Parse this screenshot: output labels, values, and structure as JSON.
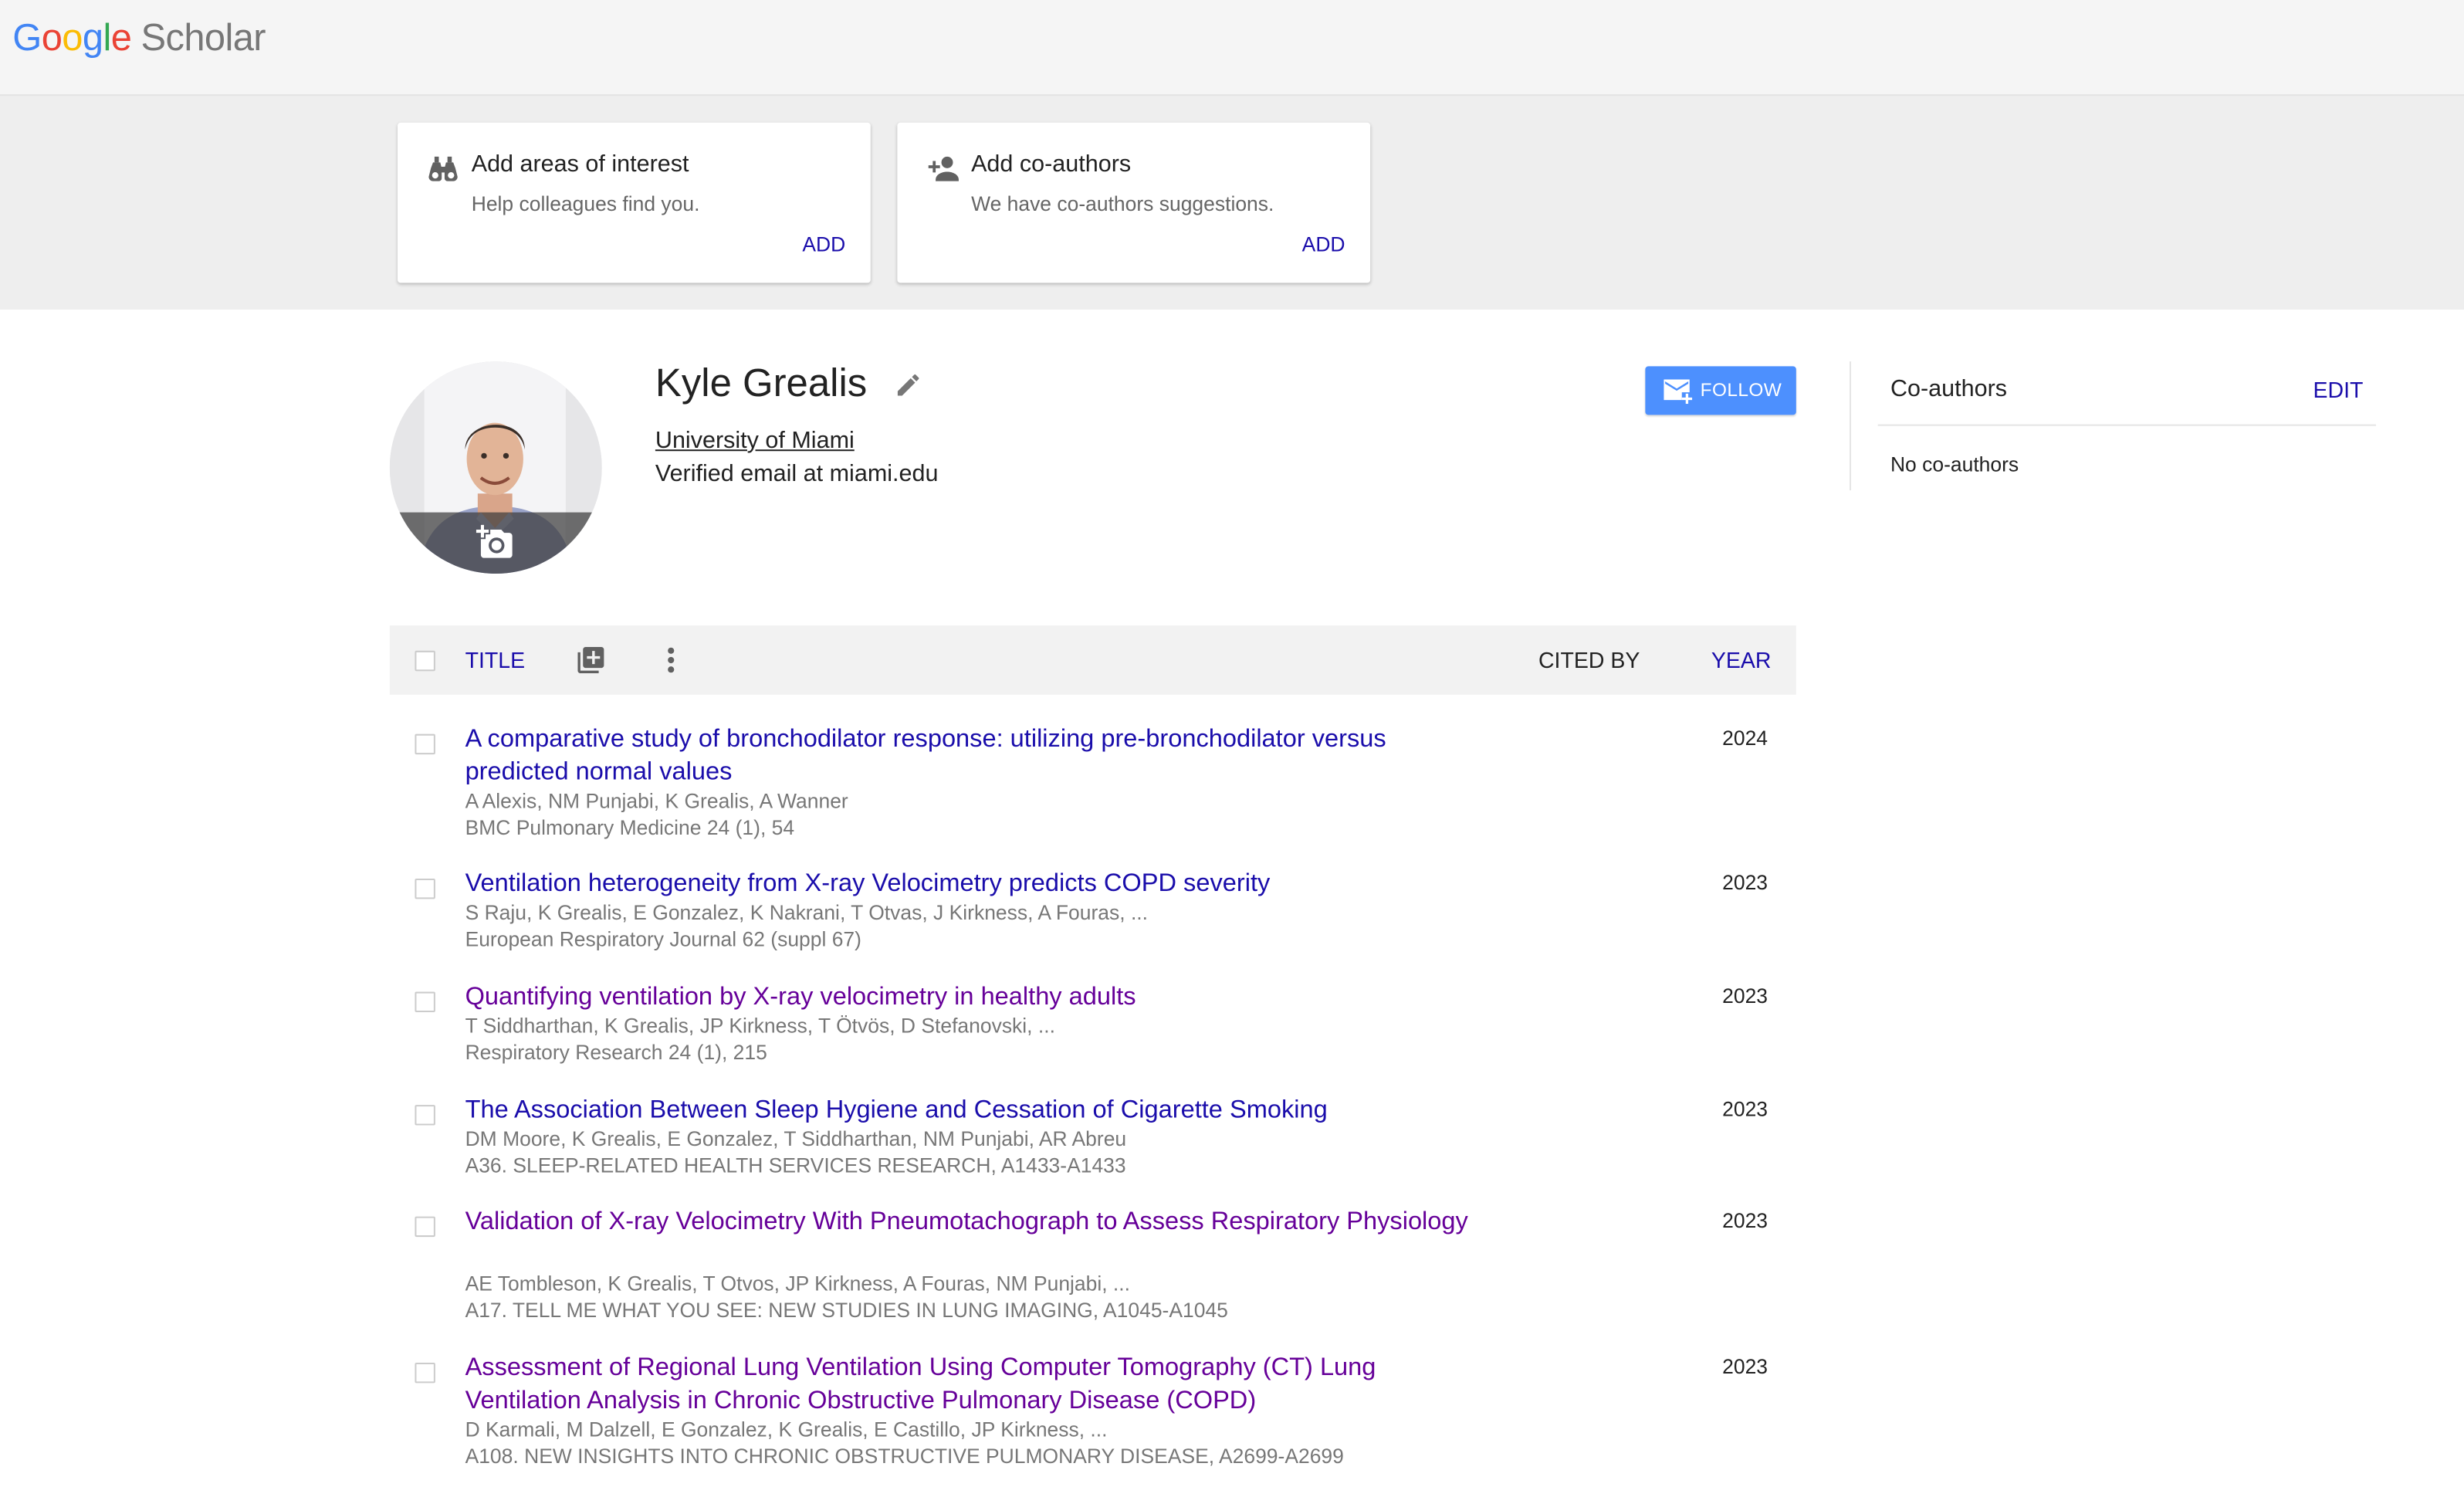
{
  "header": {
    "logo_google": [
      "G",
      "o",
      "o",
      "g",
      "l",
      "e"
    ],
    "logo_scholar": "Scholar"
  },
  "suggestions": [
    {
      "title": "Add areas of interest",
      "subtitle": "Help colleagues find you.",
      "action": "ADD",
      "icon": "binoculars-icon"
    },
    {
      "title": "Add co-authors",
      "subtitle": "We have co-authors suggestions.",
      "action": "ADD",
      "icon": "person-add-icon"
    }
  ],
  "profile": {
    "name": "Kyle Grealis",
    "affiliation": "University of Miami",
    "email": "Verified email at miami.edu",
    "follow_label": "FOLLOW"
  },
  "coauthors": {
    "title": "Co-authors",
    "edit_label": "EDIT",
    "empty_text": "No co-authors"
  },
  "table": {
    "col_title": "TITLE",
    "col_cited": "CITED BY",
    "col_year": "YEAR"
  },
  "articles": [
    {
      "title": "A comparative study of bronchodilator response: utilizing pre-bronchodilator versus predicted normal values",
      "authors": "A Alexis, NM Punjabi, K Grealis, A Wanner",
      "venue": "BMC Pulmonary Medicine 24 (1), 54",
      "year": "2024",
      "visited": false
    },
    {
      "title": "Ventilation heterogeneity from X-ray Velocimetry predicts COPD severity",
      "authors": "S Raju, K Grealis, E Gonzalez, K Nakrani, T Otvas, J Kirkness, A Fouras, ...",
      "venue": "European Respiratory Journal 62 (suppl 67)",
      "year": "2023",
      "visited": false
    },
    {
      "title": "Quantifying ventilation by X-ray velocimetry in healthy adults",
      "authors": "T Siddharthan, K Grealis, JP Kirkness, T Ötvös, D Stefanovski, ...",
      "venue": "Respiratory Research 24 (1), 215",
      "year": "2023",
      "visited": true
    },
    {
      "title": "The Association Between Sleep Hygiene and Cessation of Cigarette Smoking",
      "authors": "DM Moore, K Grealis, E Gonzalez, T Siddharthan, NM Punjabi, AR Abreu",
      "venue": "A36. SLEEP-RELATED HEALTH SERVICES RESEARCH, A1433-A1433",
      "year": "2023",
      "visited": false
    },
    {
      "title": "Validation of X-ray Velocimetry With Pneumotachograph to Assess Respiratory Physiology",
      "authors": "AE Tombleson, K Grealis, T Otvos, JP Kirkness, A Fouras, NM Punjabi, ...",
      "venue": "A17. TELL ME WHAT YOU SEE: NEW STUDIES IN LUNG IMAGING, A1045-A1045",
      "year": "2023",
      "visited": true
    },
    {
      "title": "Assessment of Regional Lung Ventilation Using Computer Tomography (CT) Lung Ventilation Analysis in Chronic Obstructive Pulmonary Disease (COPD)",
      "authors": "D Karmali, M Dalzell, E Gonzalez, K Grealis, E Castillo, JP Kirkness, ...",
      "venue": "A108. NEW INSIGHTS INTO CHRONIC OBSTRUCTIVE PULMONARY DISEASE, A2699-A2699",
      "year": "2023",
      "visited": true
    }
  ],
  "colors": {
    "link": "#1a0dab",
    "visited": "#660099",
    "follow_button": "#4d90fe",
    "header_bg": "#f5f5f5"
  }
}
